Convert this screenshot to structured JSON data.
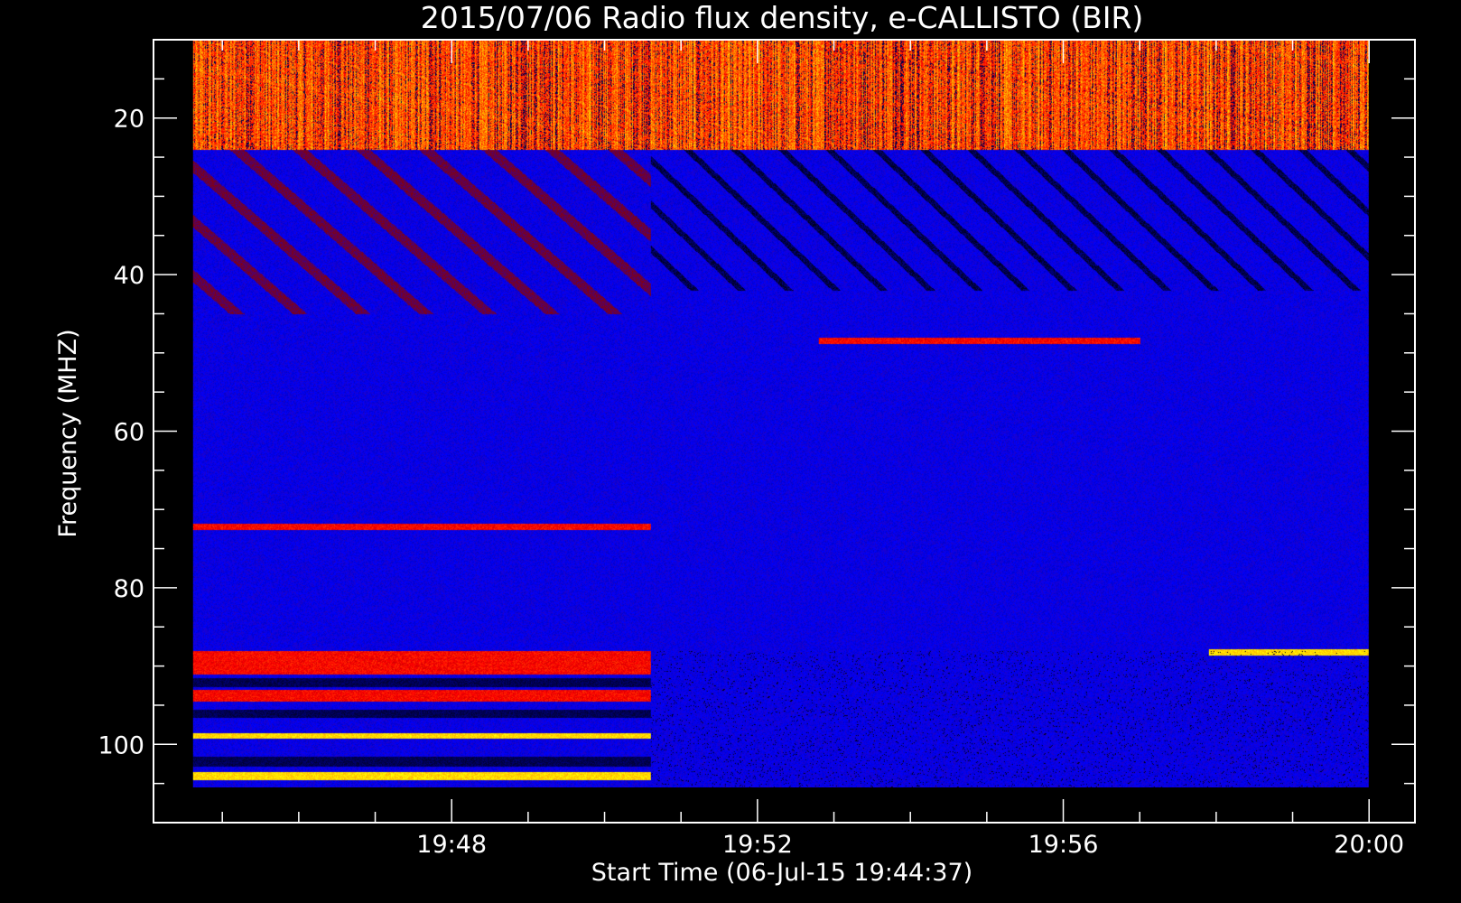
{
  "chart_data": {
    "type": "heatmap",
    "title": "2015/07/06  Radio flux density, e-CALLISTO (BIR)",
    "xlabel": "Start Time (06-Jul-15 19:44:37)",
    "ylabel": "Frequency (MHZ)",
    "x_ticks": [
      {
        "label": "19:48",
        "minutes": 48
      },
      {
        "label": "19:52",
        "minutes": 52
      },
      {
        "label": "19:56",
        "minutes": 56
      },
      {
        "label": "20:00",
        "minutes": 60
      }
    ],
    "y_ticks": [
      {
        "label": "20",
        "value": 20
      },
      {
        "label": "40",
        "value": 40
      },
      {
        "label": "60",
        "value": 60
      },
      {
        "label": "80",
        "value": 80
      },
      {
        "label": "100",
        "value": 100
      }
    ],
    "xlim_minutes": [
      44.1,
      60.6
    ],
    "ylim_mhz": [
      10,
      110
    ],
    "data_extent": {
      "t_start": 44.617,
      "t_end": 60.0,
      "f_min": 10,
      "f_max": 105.5,
      "t_switch": 50.6
    },
    "colormap": [
      "#000000",
      "#0000ff",
      "#8b0000",
      "#ff0000",
      "#ff8c00",
      "#ffff00",
      "#ffffff"
    ],
    "features": [
      {
        "kind": "band",
        "f1": 10,
        "f2": 24,
        "t1": 44.6,
        "t2": 60.0,
        "level": "high"
      },
      {
        "kind": "band",
        "f1": 71.8,
        "f2": 72.6,
        "t1": 44.6,
        "t2": 50.6,
        "level": "red"
      },
      {
        "kind": "band",
        "f1": 88,
        "f2": 91,
        "t1": 44.6,
        "t2": 50.6,
        "level": "red"
      },
      {
        "kind": "band",
        "f1": 93,
        "f2": 94.5,
        "t1": 44.6,
        "t2": 50.6,
        "level": "red"
      },
      {
        "kind": "band",
        "f1": 98.5,
        "f2": 99.2,
        "t1": 44.6,
        "t2": 50.6,
        "level": "yellow"
      },
      {
        "kind": "band",
        "f1": 103.5,
        "f2": 104.5,
        "t1": 44.6,
        "t2": 50.6,
        "level": "yellow"
      },
      {
        "kind": "band",
        "f1": 87.8,
        "f2": 88.6,
        "t1": 57.9,
        "t2": 60.0,
        "level": "yellow"
      },
      {
        "kind": "band",
        "f1": 48,
        "f2": 48.8,
        "t1": 52.8,
        "t2": 57.0,
        "level": "red"
      }
    ]
  }
}
